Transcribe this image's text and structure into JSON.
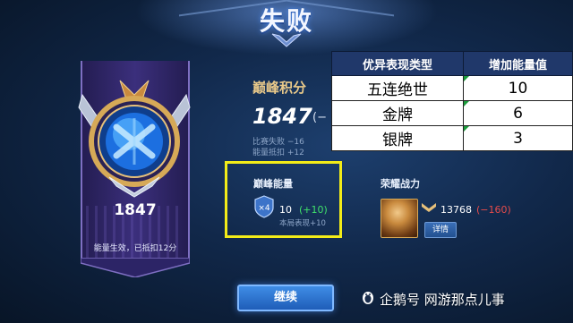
{
  "header": {
    "title": "失败"
  },
  "banner": {
    "score": "1847",
    "note": "能量生效，已抵扣12分",
    "medal_icon": "peak-medal-icon"
  },
  "peak": {
    "label": "巅峰积分",
    "value": "1847",
    "delta": "(−",
    "lines": [
      "比赛失败 −16",
      "能量抵扣 +12"
    ]
  },
  "performance_table": {
    "headers": [
      "优异表现类型",
      "增加能量值"
    ],
    "rows": [
      {
        "type": "五连绝世",
        "value": "10"
      },
      {
        "type": "金牌",
        "value": "6"
      },
      {
        "type": "银牌",
        "value": "3"
      }
    ]
  },
  "energy": {
    "label": "巅峰能量",
    "badge": "×4",
    "value": "10",
    "delta": "(+10)",
    "sub": "本局表现+10"
  },
  "glory": {
    "label": "荣耀战力",
    "value": "13768",
    "delta": "(−160)",
    "detail_button": "详情"
  },
  "continue_button": "继续",
  "watermark": "企鹅号 网游那点儿事",
  "colors": {
    "highlight_box": "#f3ec18",
    "positive": "#3fe06a",
    "negative": "#e54b4b",
    "table_header": "#20386a"
  }
}
